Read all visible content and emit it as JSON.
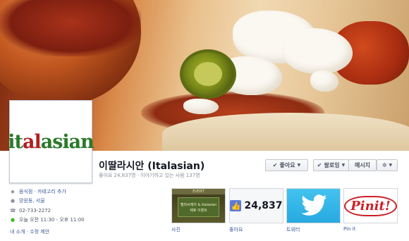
{
  "page": {
    "name": "이딸라시안 (Italasian)",
    "stats": "좋아요 24,837명 · 이야기하고 있는 사람 137명",
    "logo": {
      "it": "it",
      "al": "al",
      "asian": "asian"
    }
  },
  "buttons": {
    "like": "좋아요",
    "following": "팔로잉",
    "message": "메시지"
  },
  "info": {
    "category": "음식점 · 카테고리 추가",
    "address": "망원동, 서울",
    "phone": "02-733-2272",
    "hours": "오늘 오전 11:30 - 오후 11:00",
    "about": "내 소개 · 수정 제안"
  },
  "tiles": {
    "photos": {
      "label": "사진",
      "event_tag": "EVENT",
      "card_line1": "멜라씨에이 & Italasian",
      "card_line2": "제휴 이벤트"
    },
    "likes": {
      "label": "좋아요",
      "count": "24,837"
    },
    "twitter": {
      "label": "트위터"
    },
    "pinit": {
      "label": "Pin it",
      "logo": "Pinit!"
    }
  },
  "colors": {
    "link": "#3b5998",
    "twitter": "#27a9e1",
    "pinterest": "#cb2027",
    "brand_green": "#2b7a2b",
    "brand_red": "#b2201e"
  }
}
